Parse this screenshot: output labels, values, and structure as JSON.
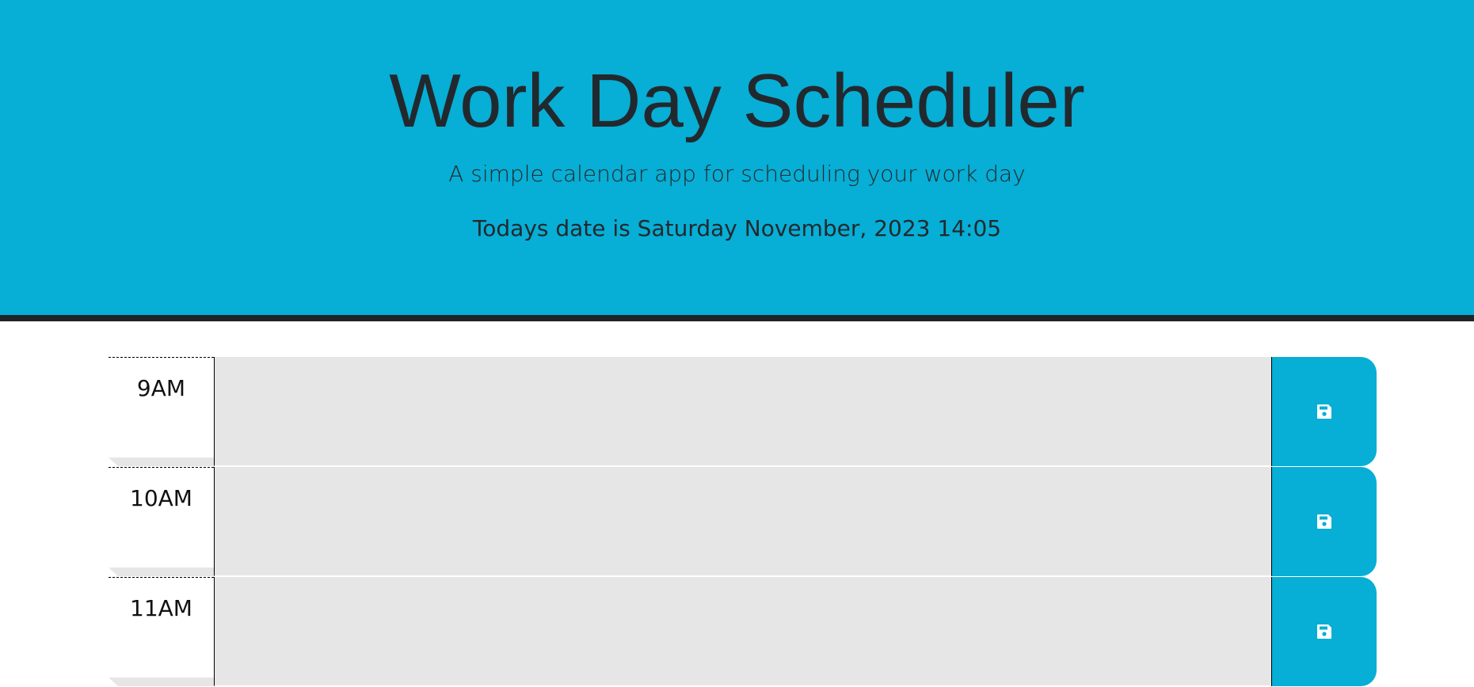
{
  "header": {
    "title": "Work Day Scheduler",
    "subtitle": "A simple calendar app for scheduling your work day",
    "date_text": "Todays date is Saturday November, 2023 14:05"
  },
  "colors": {
    "accent": "#07aed5",
    "header_border": "#1d2327",
    "past_row": "#e6e6e6",
    "text": "#22292e"
  },
  "schedule": {
    "hours": [
      {
        "label": "9AM",
        "description": "",
        "state": "past",
        "save_icon": "save-icon"
      },
      {
        "label": "10AM",
        "description": "",
        "state": "past",
        "save_icon": "save-icon"
      },
      {
        "label": "11AM",
        "description": "",
        "state": "past",
        "save_icon": "save-icon"
      }
    ]
  }
}
